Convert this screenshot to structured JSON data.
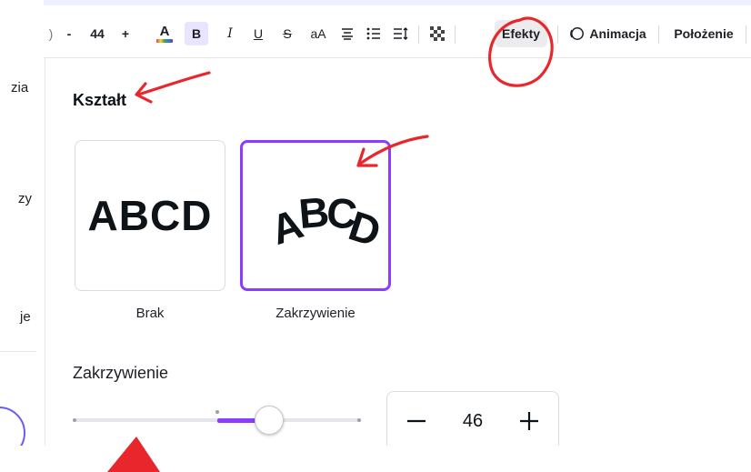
{
  "toolbar": {
    "font_size": "44",
    "minus": "-",
    "plus": "+",
    "color_letter": "A",
    "bold": "B",
    "italic": "I",
    "underline": "U",
    "strikethrough": "S",
    "letter_case": "aA",
    "efekty": "Efekty",
    "animacja": "Animacja",
    "polozenie": "Położenie"
  },
  "left_nav": {
    "items": [
      "zia",
      "zy",
      "je"
    ]
  },
  "panel": {
    "section_title": "Kształt",
    "options": [
      {
        "label": "Brak",
        "preview": "ABCD",
        "selected": false
      },
      {
        "label": "Zakrzywienie",
        "preview": "ABCD",
        "selected": true
      }
    ],
    "slider_label": "Zakrzywienie",
    "slider_value_fraction": 0.68,
    "stepper": {
      "value": "46",
      "minus": "—",
      "plus": "+"
    }
  },
  "colors": {
    "accent": "#8b3dff",
    "annotation": "#e8262b"
  }
}
